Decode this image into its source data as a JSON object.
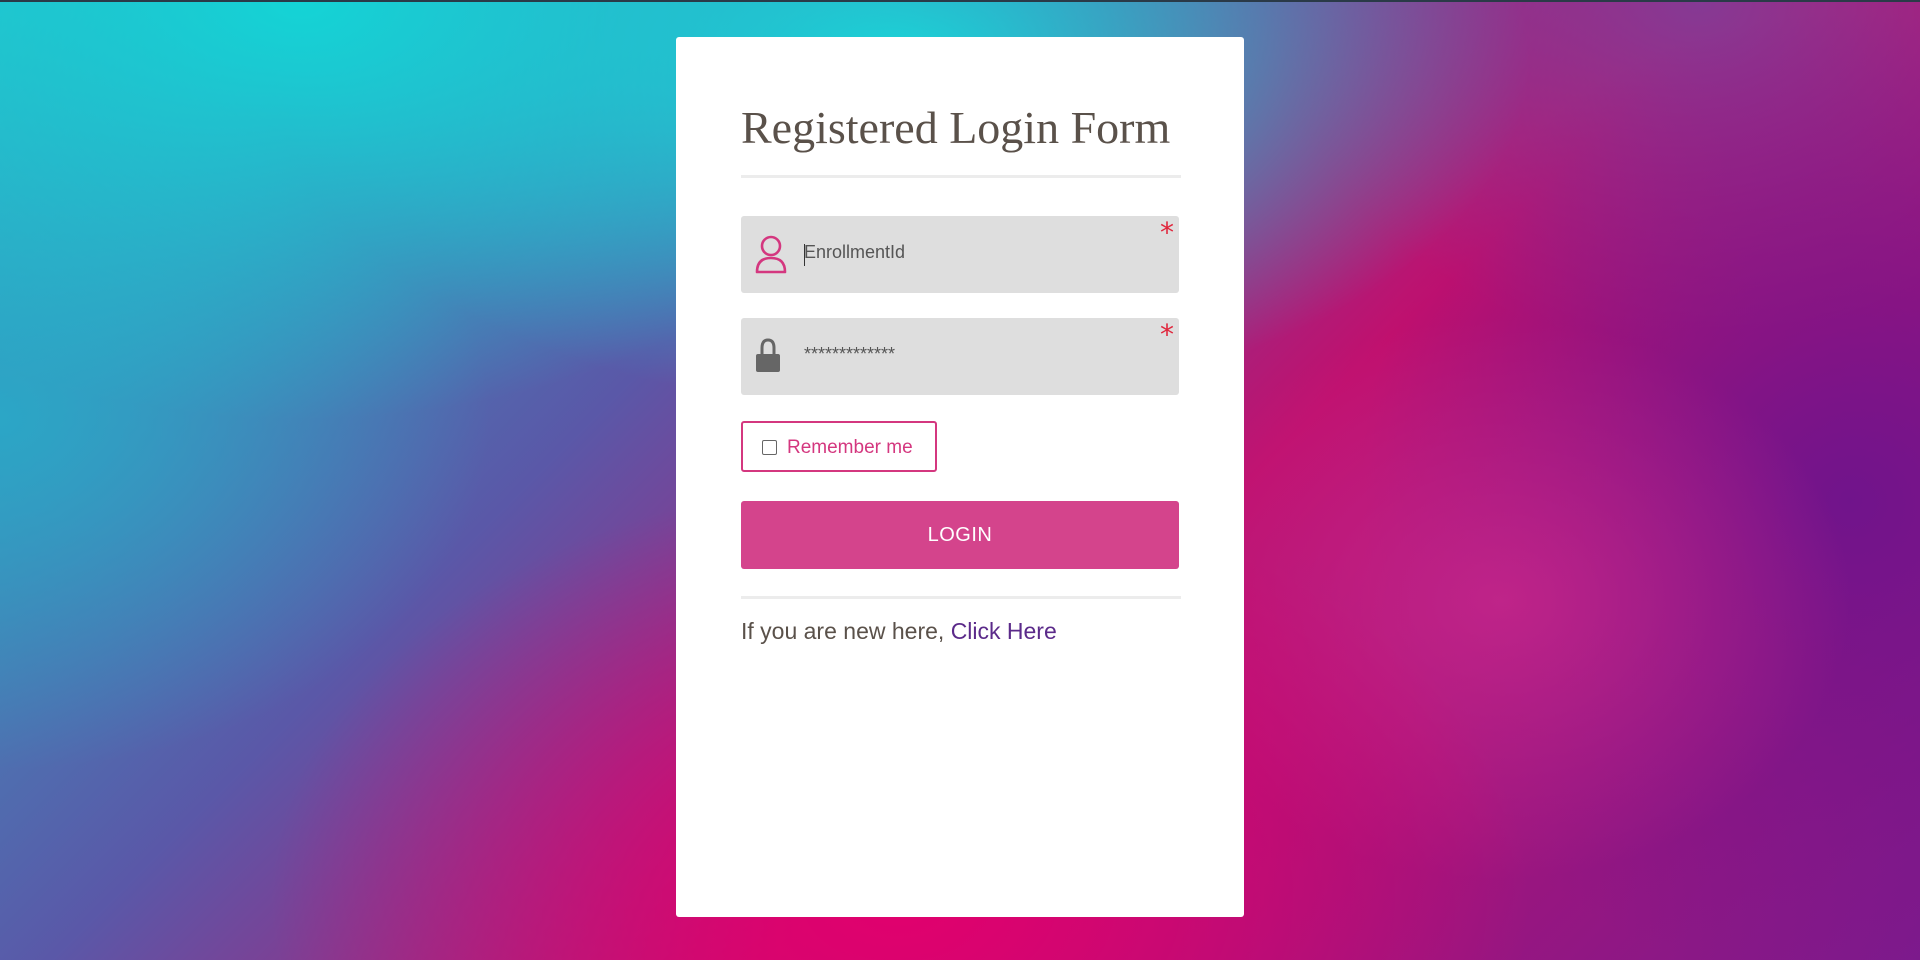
{
  "form": {
    "title": "Registered Login Form",
    "enrollment": {
      "value": "EnrollmentId",
      "required_mark": "*",
      "icon": "user-icon"
    },
    "password": {
      "value": "*************",
      "required_mark": "*",
      "icon": "lock-icon"
    },
    "remember_label": "Remember me",
    "remember_checked": false,
    "login_label": "LOGIN",
    "new_here_text": "If you are new here,",
    "click_here_label": "Click Here"
  },
  "colors": {
    "accent": "#d4448c",
    "link": "#5b2a8a",
    "required": "#e0263c",
    "field_bg": "#dedede",
    "title": "#5a514a"
  }
}
